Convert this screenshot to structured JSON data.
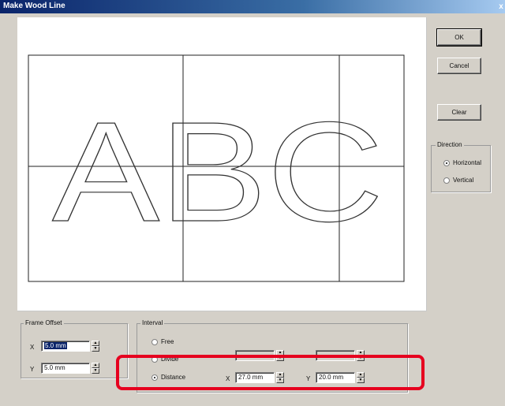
{
  "window": {
    "title": "Make Wood Line",
    "close_glyph": "x"
  },
  "preview": {
    "letters": "ABC"
  },
  "buttons": {
    "ok": "OK",
    "cancel": "Cancel",
    "clear": "Clear"
  },
  "direction": {
    "label": "Direction",
    "horizontal": "Horizontal",
    "vertical": "Vertical",
    "selected": "Horizontal"
  },
  "frame_offset": {
    "label": "Frame Offset",
    "x_label": "X",
    "x_value": "5.0 mm",
    "y_label": "Y",
    "y_value": "5.0 mm"
  },
  "interval": {
    "label": "Interval",
    "free": "Free",
    "divide": "Divide",
    "distance": "Distance",
    "selected": "Distance",
    "x_label": "X",
    "x_value": "27.0 mm",
    "y_label": "Y",
    "y_value": "20.0 mm"
  },
  "colors": {
    "highlight": "#e6001f",
    "titlebar": "#0a246a"
  },
  "icons": {
    "spin_up": "spin-up-arrow-icon",
    "spin_down": "spin-down-arrow-icon"
  }
}
